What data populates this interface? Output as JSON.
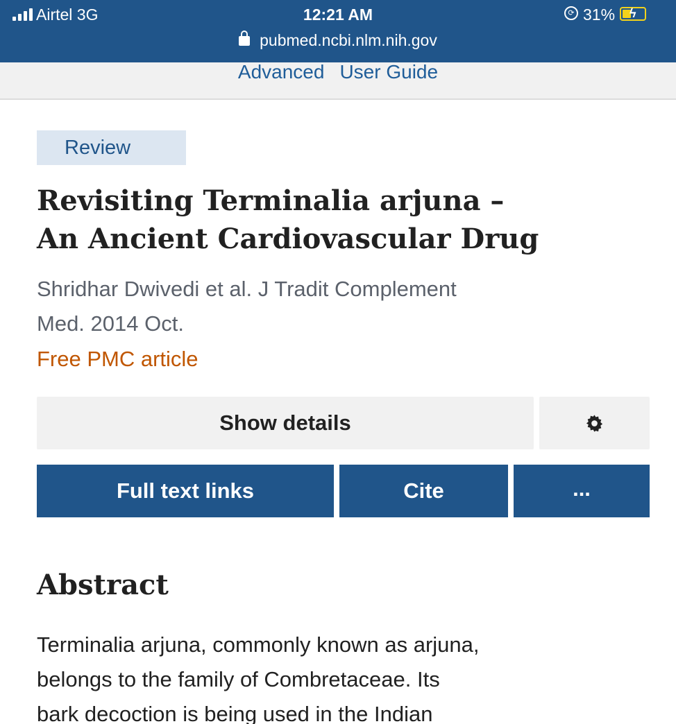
{
  "status_bar": {
    "carrier": "Airtel  3G",
    "time": "12:21 AM",
    "battery_pct": "31%"
  },
  "browser": {
    "url": "pubmed.ncbi.nlm.nih.gov"
  },
  "subheader": {
    "advanced": "Advanced",
    "user_guide": "User Guide"
  },
  "article": {
    "badge": "Review",
    "title_line1": "Revisiting Terminalia arjuna –",
    "title_line2": "An Ancient Cardiovascular Drug",
    "citation_line1": "Shridhar Dwivedi et al. J Tradit Complement",
    "citation_line2": "Med. 2014 Oct.",
    "free_label": "Free PMC article"
  },
  "actions": {
    "show_details": "Show details",
    "full_text_links": "Full text links",
    "cite": "Cite",
    "more": "..."
  },
  "abstract": {
    "heading": "Abstract",
    "line1": "Terminalia arjuna, commonly known as arjuna,",
    "line2": "belongs to the family of Combretaceae. Its",
    "line3": "bark decoction is being used in the Indian"
  },
  "colors": {
    "header_blue": "#20558a",
    "link_blue": "#1f5d99",
    "free_orange": "#c05600",
    "battery_yellow": "#f3d21b"
  },
  "icons": [
    "signal-icon",
    "rotation-lock-icon",
    "battery-icon",
    "lock-icon",
    "gear-icon"
  ]
}
